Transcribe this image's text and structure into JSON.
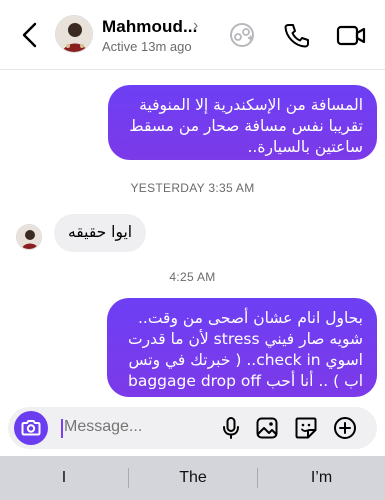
{
  "header": {
    "contact_name": "Mahmoud...",
    "status": "Active 13m ago",
    "icons": [
      "back-chevron-icon",
      "avatar",
      "chevron-right-icon",
      "game-controller-icon",
      "phone-icon",
      "video-camera-icon"
    ]
  },
  "messages": {
    "msg1": "المسافة من الإسكندرية إلا المنوفية تقريبا نفس مسافة صحار من مسقط ساعتين بالسيارة..",
    "timestamp1": "YESTERDAY 3:35 AM",
    "msg2": "ايوا حقيقه",
    "timestamp2": "4:25 AM",
    "msg3": "بحاول انام عشان أصحى من وقت.. شويه صار فيني stress لأن ما قدرت اسوي check in.. ( خبرتك في وتس اب ) .. أنا أحب baggage drop off"
  },
  "composer": {
    "placeholder": "Message...",
    "icons": [
      "camera-icon",
      "microphone-icon",
      "photo-icon",
      "sticker-icon",
      "plus-icon"
    ]
  },
  "keyboard": {
    "suggestions": [
      "I",
      "The",
      "I’m"
    ]
  },
  "colors": {
    "accent": "#7a3ff2",
    "incoming_bubble": "#efeff1",
    "keyboard_bg": "#d3d5da"
  }
}
